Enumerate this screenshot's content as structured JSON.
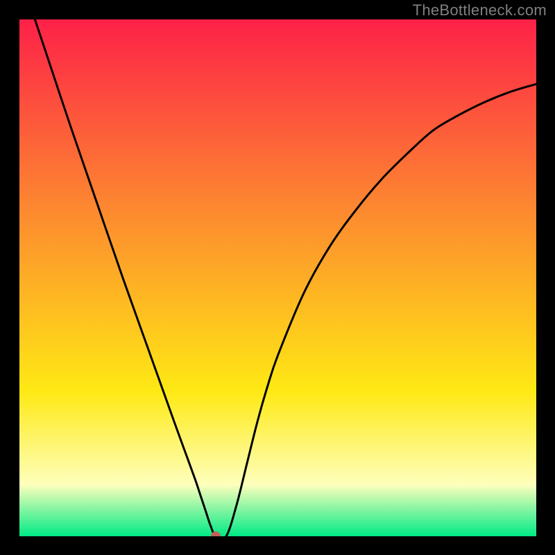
{
  "watermark": "TheBottleneck.com",
  "chart_data": {
    "type": "line",
    "title": "",
    "xlabel": "",
    "ylabel": "",
    "xlim": [
      0,
      100
    ],
    "ylim": [
      0,
      100
    ],
    "grid": false,
    "background_gradient": {
      "top_color": "#fd2148",
      "mid_upper_color": "#fd8c2f",
      "mid_color": "#fee914",
      "lower_color": "#feffbc",
      "bottom_color": "#00ea86"
    },
    "series": [
      {
        "name": "curve",
        "x": [
          3.0,
          5,
          10,
          15,
          20,
          25,
          30,
          32,
          34,
          35,
          36,
          37,
          38,
          40,
          42,
          44,
          46,
          48,
          50,
          55,
          60,
          65,
          70,
          75,
          80,
          85,
          90,
          95,
          100
        ],
        "y": [
          100,
          94,
          79,
          64.5,
          50,
          36,
          22,
          16.5,
          11,
          8,
          5,
          2,
          0,
          0,
          6,
          14,
          22,
          29,
          35,
          47,
          56,
          63,
          69,
          74,
          78.5,
          81.5,
          84,
          86,
          87.5
        ]
      }
    ],
    "marker": {
      "name": "bottleneck-point",
      "x": 38,
      "y": 0,
      "color": "#c25f5a",
      "radius_px": 7
    }
  }
}
